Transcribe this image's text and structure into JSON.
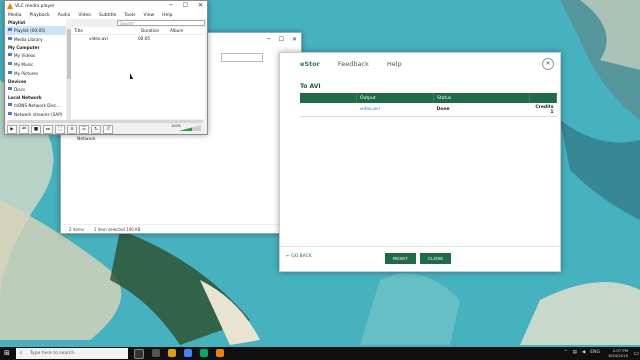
{
  "vlc": {
    "title": "VLC media player",
    "menu": [
      "Media",
      "Playback",
      "Audio",
      "Video",
      "Subtitle",
      "Tools",
      "View",
      "Help"
    ],
    "sidebar": {
      "playlist_header": "Playlist",
      "playlist_items": [
        "Playlist (00:05)",
        "Media Library"
      ],
      "mycomputer_header": "My Computer",
      "mycomputer_items": [
        "My Videos",
        "My Music",
        "My Pictures"
      ],
      "devices_header": "Devices",
      "devices_items": [
        "Discs"
      ],
      "local_header": "Local Network",
      "local_items": [
        "mDNS Network Disc...",
        "Network streams (SAP)"
      ]
    },
    "search_placeholder": "Search",
    "columns": [
      "Title",
      "Duration",
      "Album"
    ],
    "rows": [
      {
        "title": "video.avi",
        "duration": "00:05",
        "album": ""
      }
    ],
    "volume": "100%",
    "seek_fraction": 0
  },
  "explorer": {
    "search_placeholder": "Search MyFiles",
    "status_items": "2 items",
    "status_selected": "1 item selected  100 KB",
    "nav_network": "Network"
  },
  "converter": {
    "brand": "eStor",
    "nav": [
      "Feedback",
      "Help"
    ],
    "section_title": "To AVI",
    "columns": [
      "",
      "Output",
      "Status"
    ],
    "rows": [
      {
        "input": "",
        "output": "video.avi",
        "status": "Done",
        "credits": "Credits 1"
      }
    ],
    "go_back": "GO BACK",
    "reset": "RESET",
    "close": "CLOSE"
  },
  "taskbar": {
    "search_placeholder": "Type here to search",
    "time": "2:07 PM",
    "date": "8/24/2019",
    "lang": "ENG"
  },
  "colors": {
    "accent_green": "#1f6b45",
    "vlc_orange": "#f08000",
    "link_blue": "#2a7bbf"
  }
}
